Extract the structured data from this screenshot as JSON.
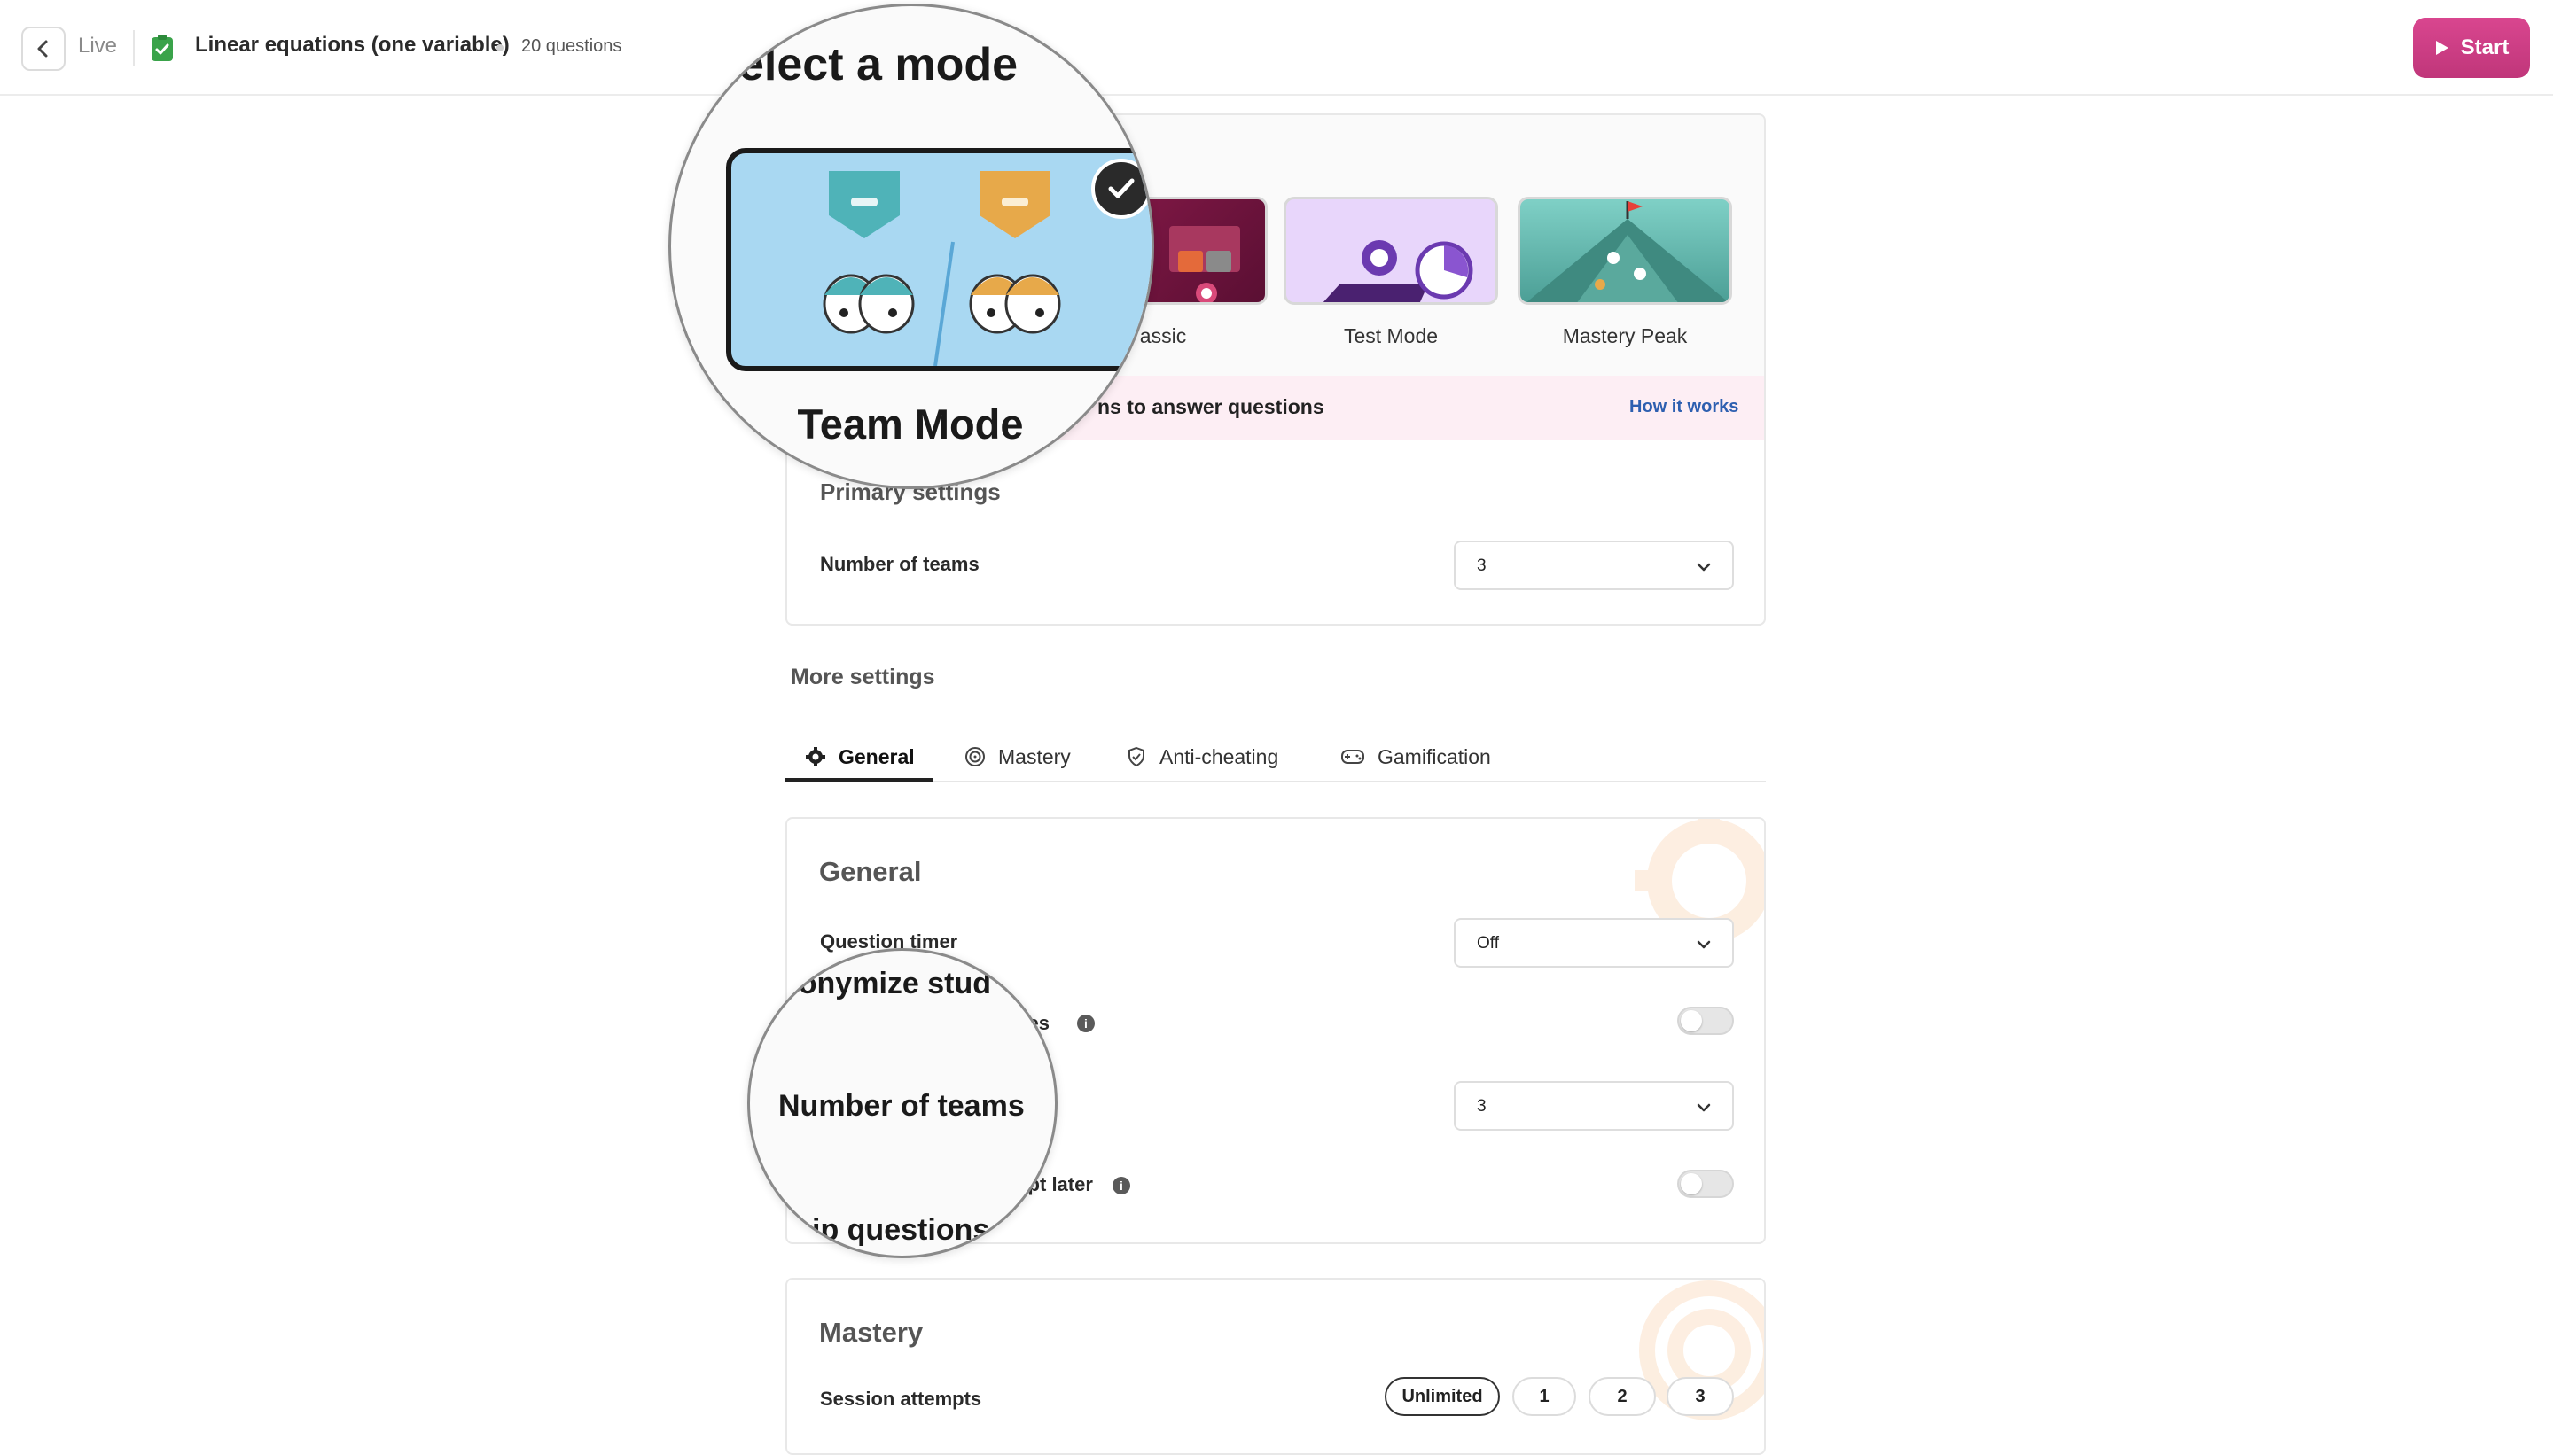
{
  "header": {
    "live_label": "Live",
    "quiz_title": "Linear equations (one variable)",
    "question_count": "20 questions",
    "start_label": "Start"
  },
  "modes": {
    "heading": "Select a mode",
    "items": [
      {
        "label": "Team Mode",
        "selected": true
      },
      {
        "label": "Classic",
        "selected": false
      },
      {
        "label": "Test Mode",
        "selected": false
      },
      {
        "label": "Mastery Peak",
        "selected": false
      }
    ],
    "description": "Participants compete in teams to answer questions",
    "how_it_works": "How it works"
  },
  "primary_settings": {
    "title": "Primary settings",
    "number_of_teams_label": "Number of teams",
    "number_of_teams_value": "3"
  },
  "more_settings": {
    "title": "More settings",
    "tabs": [
      {
        "label": "General",
        "icon": "gear-icon",
        "active": true
      },
      {
        "label": "Mastery",
        "icon": "mastery-icon",
        "active": false
      },
      {
        "label": "Anti-cheating",
        "icon": "shield-check-icon",
        "active": false
      },
      {
        "label": "Gamification",
        "icon": "gamepad-icon",
        "active": false
      }
    ]
  },
  "general": {
    "title": "General",
    "question_timer_label": "Question timer",
    "question_timer_value": "Off",
    "anonymize_label": "Anonymize student names",
    "anonymize_on": false,
    "teams_label": "Number of teams",
    "teams_value": "3",
    "skip_label": "Skip questions & attempt later",
    "skip_on": false
  },
  "mastery": {
    "title": "Mastery",
    "session_attempts_label": "Session attempts",
    "options": [
      "Unlimited",
      "1",
      "2",
      "3"
    ],
    "selected": "Unlimited"
  },
  "magnifier_top": {
    "heading": "elect a mode",
    "label": "Team Mode"
  },
  "magnifier_bottom": {
    "top_text": "nonymize stud",
    "main_text": "Number of teams",
    "bottom_text": "ip questions"
  },
  "colors": {
    "accent": "#c8397f",
    "team_mode_bg": "#a9d8f2",
    "teal_team": "#4fb3b8",
    "gold_team": "#e7a94a",
    "info_bar": "#fdeef4",
    "link": "#2d5fb0"
  }
}
